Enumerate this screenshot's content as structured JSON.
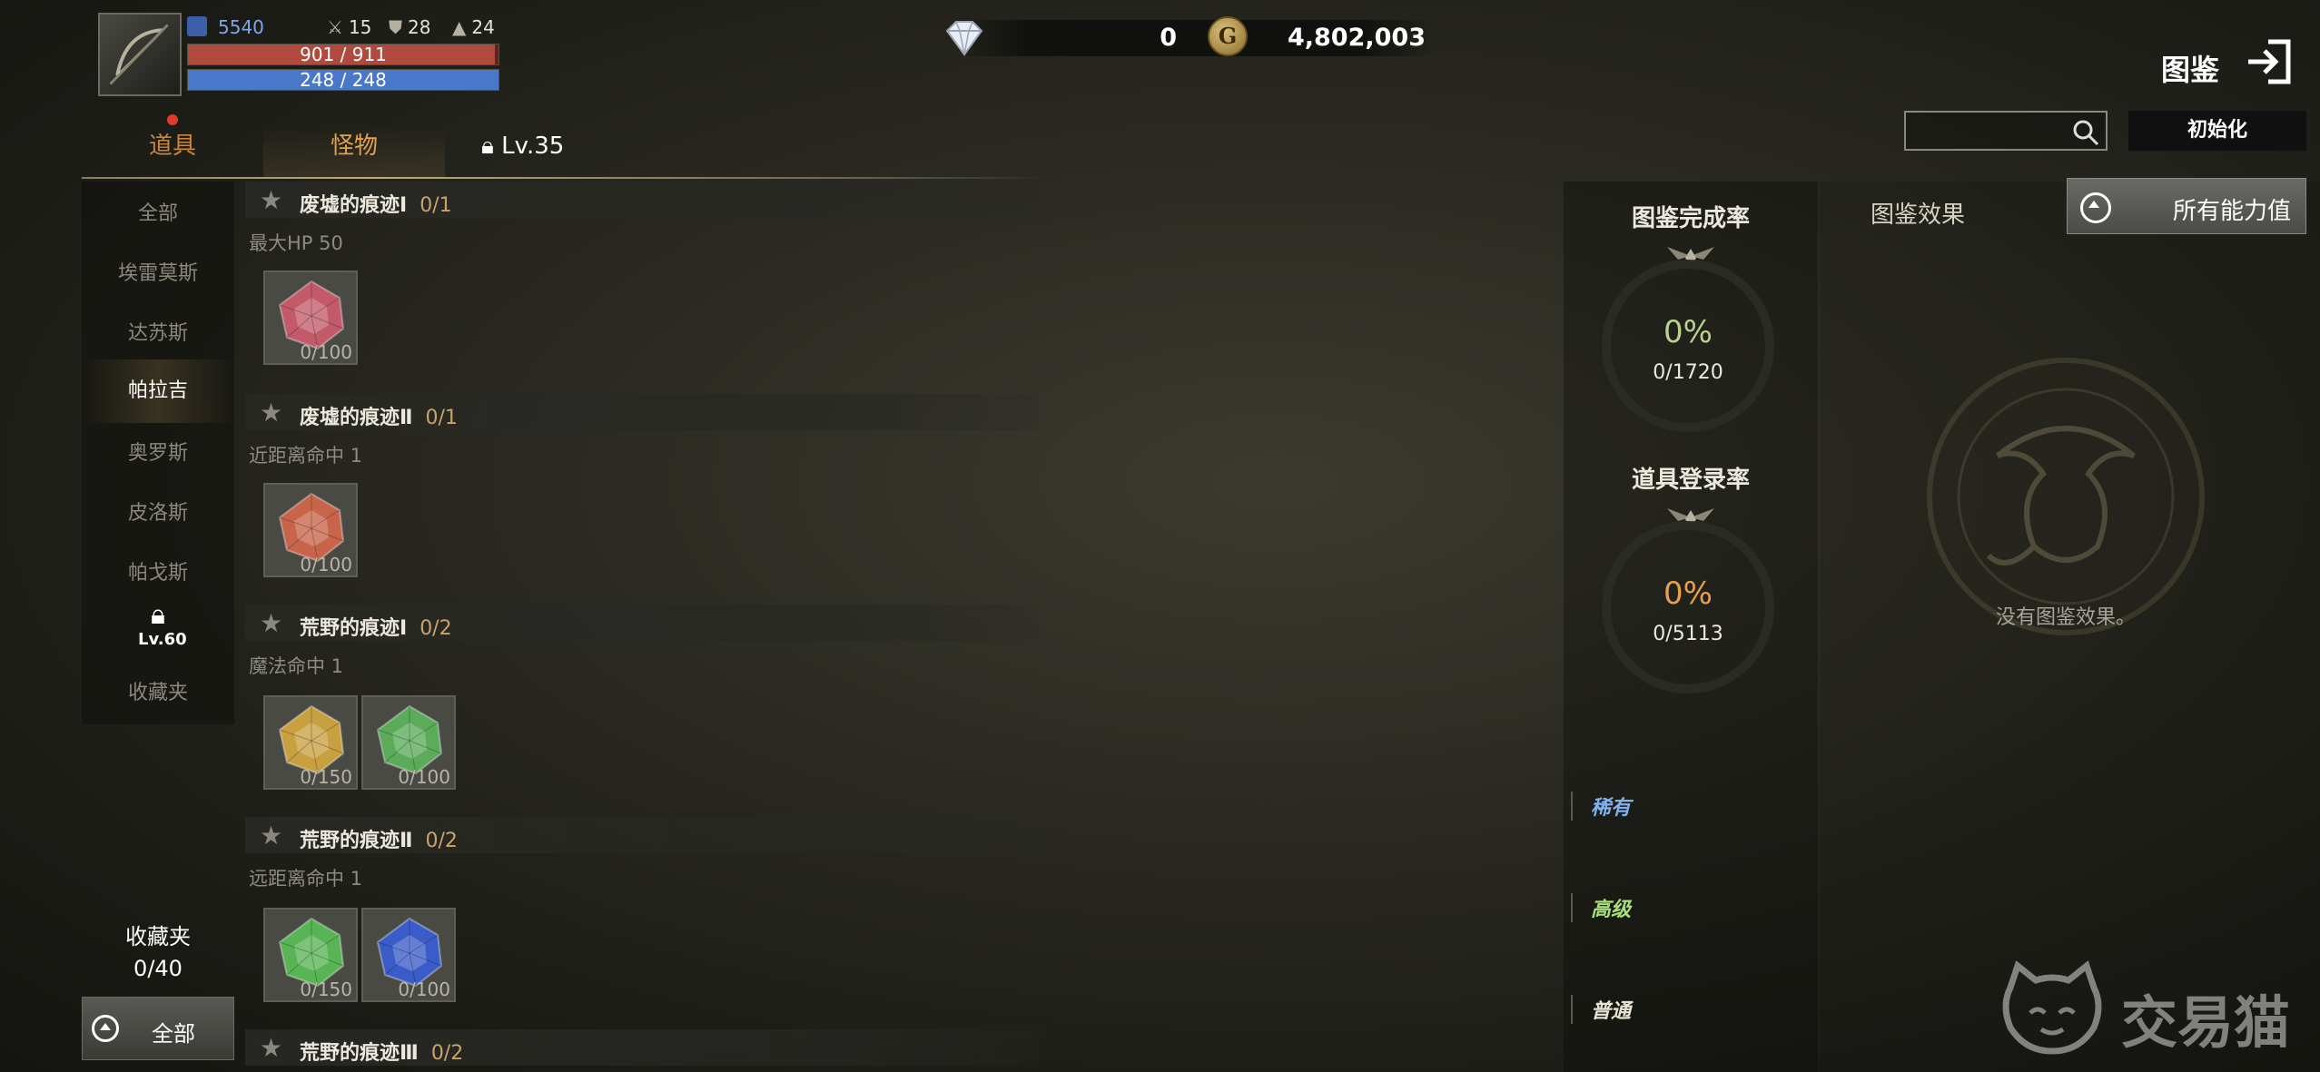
{
  "hud": {
    "power": "5540",
    "stats": [
      {
        "icon": "crossed-swords-icon",
        "value": "15"
      },
      {
        "icon": "shield-icon",
        "value": "28"
      },
      {
        "icon": "hat-icon",
        "value": "24"
      }
    ],
    "hp": "901 / 911",
    "hp_fill": 0.989,
    "mp": "248 / 248",
    "mp_fill": 1.0,
    "diamond": "0",
    "gold_symbol": "G",
    "gold": "4,802,003"
  },
  "header": {
    "title": "图鉴"
  },
  "tabs": {
    "items": "道具",
    "monsters": "怪物",
    "locked_level": "Lv.35"
  },
  "search": {
    "placeholder": "",
    "reset_label": "初始化"
  },
  "regions": {
    "items": [
      "全部",
      "埃雷莫斯",
      "达苏斯",
      "帕拉吉",
      "奥罗斯",
      "皮洛斯",
      "帕戈斯"
    ],
    "active": "帕拉吉",
    "locked_level": "Lv.60",
    "favorites": "收藏夹"
  },
  "favorites_box": {
    "label": "收藏夹",
    "count": "0/40"
  },
  "filter_button": "全部",
  "entries": [
    {
      "name": "废墟的痕迹Ⅰ",
      "count": "0/1",
      "stat": "最大HP 50",
      "slots": [
        {
          "color": "#c25a6a",
          "value": "0/100"
        }
      ]
    },
    {
      "name": "废墟的痕迹Ⅱ",
      "count": "0/1",
      "stat": "近距离命中 1",
      "slots": [
        {
          "color": "#c8644a",
          "value": "0/100"
        }
      ]
    },
    {
      "name": "荒野的痕迹Ⅰ",
      "count": "0/2",
      "stat": "魔法命中 1",
      "slots": [
        {
          "color": "#c8a040",
          "value": "0/150"
        },
        {
          "color": "#5cab5a",
          "value": "0/100"
        }
      ]
    },
    {
      "name": "荒野的痕迹Ⅱ",
      "count": "0/2",
      "stat": "远距离命中 1",
      "slots": [
        {
          "color": "#58b454",
          "value": "0/150"
        },
        {
          "color": "#3a5cc8",
          "value": "0/100"
        }
      ]
    },
    {
      "name": "荒野的痕迹Ⅲ",
      "count": "0/2"
    }
  ],
  "rates": {
    "completion_title": "图鉴完成率",
    "completion_pct": "0%",
    "completion_frac": "0/1720",
    "registration_title": "道具登录率",
    "registration_pct": "0%",
    "registration_frac": "0/5113",
    "grades": [
      {
        "label": "稀有",
        "color": "#7fb2ee"
      },
      {
        "label": "高级",
        "color": "#a8e07a"
      },
      {
        "label": "普通",
        "color": "#e6e2d6"
      }
    ]
  },
  "effects": {
    "tab_label": "图鉴效果",
    "all_stats_label": "所有能力值",
    "empty_text": "没有图鉴效果。"
  },
  "watermark": {
    "text": "交易猫"
  }
}
